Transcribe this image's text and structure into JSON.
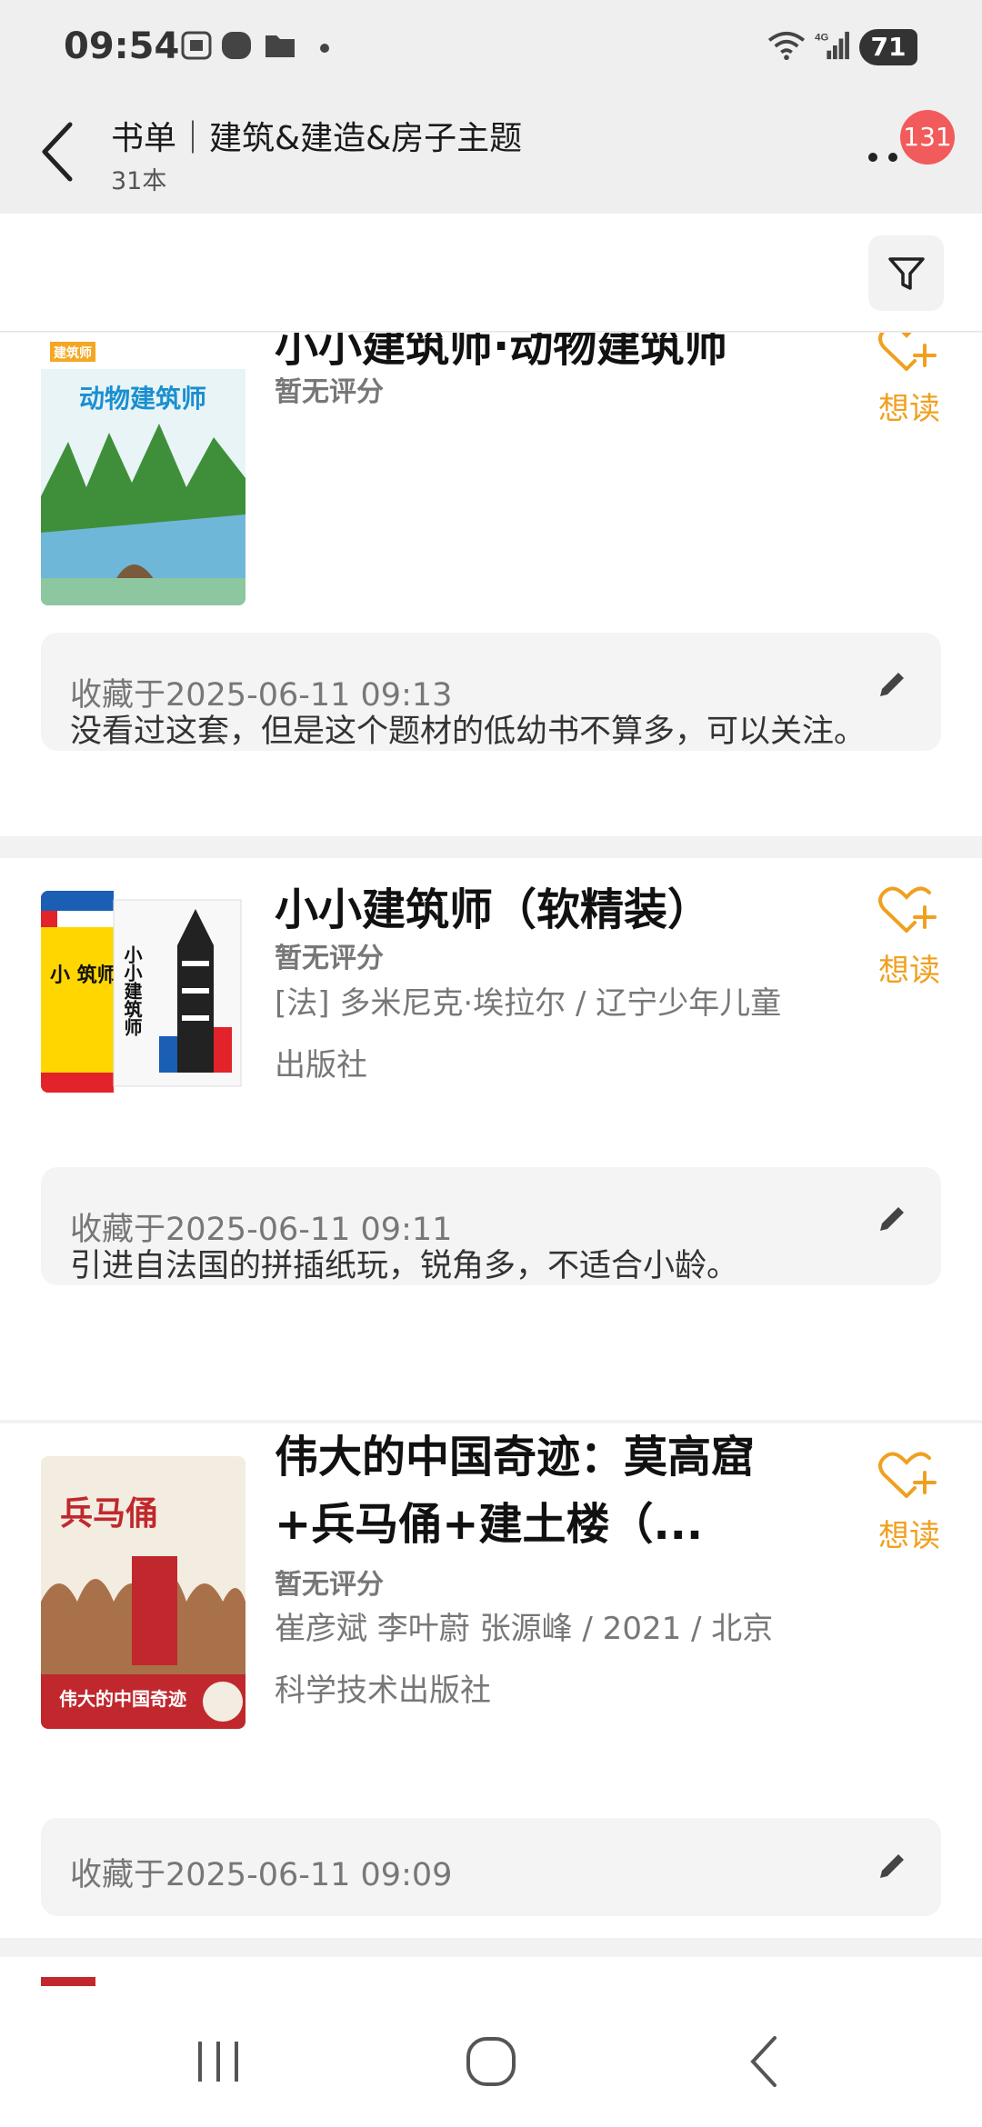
{
  "status_bar": {
    "time": "09:54",
    "battery": "71",
    "icons": [
      "screenshot-icon",
      "app-icon",
      "folder-icon",
      "dot-icon",
      "wifi-icon",
      "signal-4g-icon"
    ]
  },
  "header": {
    "title": "书单｜建筑&建造&房子主题",
    "subtitle": "31本",
    "badge": "131"
  },
  "books": [
    {
      "title": "小小建筑师·动物建筑师",
      "rating": "暂无评分",
      "meta": "",
      "want_label": "想读",
      "cover_title": "动物建筑师",
      "cover_brand": "建筑师",
      "note_date": "收藏于2025-06-11 09:13",
      "note_text": "没看过这套，但是这个题材的低幼书不算多，可以关注。"
    },
    {
      "title": "小小建筑师（软精装）",
      "rating": "暂无评分",
      "meta": "[法] 多米尼克·埃拉尔 / 辽宁少年儿童出版社",
      "want_label": "想读",
      "cover_title": "小小建筑师",
      "cover_side": "小 筑师 ",
      "note_date": "收藏于2025-06-11 09:11",
      "note_text": "引进自法国的拼插纸玩，锐角多，不适合小龄。"
    },
    {
      "title": "伟大的中国奇迹：莫高窟+兵马俑+建土楼（...",
      "rating": "暂无评分",
      "meta": "崔彦斌 李叶蔚 张源峰 / 2021 / 北京科学技术出版社",
      "want_label": "想读",
      "cover_title": "兵马俑",
      "cover_banner": "伟大的中国奇迹",
      "note_date": "收藏于2025-06-11 09:09",
      "note_text": ""
    }
  ],
  "colors": {
    "accent": "#f0a020",
    "badge": "#f25b5b",
    "background": "#f2f2f2"
  }
}
